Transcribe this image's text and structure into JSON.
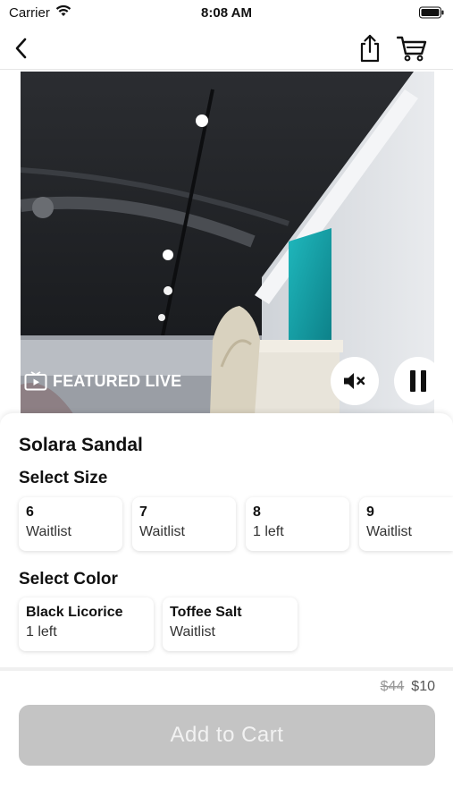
{
  "status_bar": {
    "carrier": "Carrier",
    "time": "8:08 AM"
  },
  "nav": {
    "icons": [
      "back-chevron-icon",
      "share-icon",
      "cart-icon"
    ]
  },
  "video": {
    "badge_label": "FEATURED LIVE",
    "icons": [
      "tv-play-icon",
      "mute-icon",
      "pause-icon"
    ]
  },
  "product": {
    "title": "Solara Sandal",
    "size_label": "Select Size",
    "sizes": [
      {
        "size": "6",
        "status": "Waitlist"
      },
      {
        "size": "7",
        "status": "Waitlist"
      },
      {
        "size": "8",
        "status": "1 left"
      },
      {
        "size": "9",
        "status": "Waitlist"
      }
    ],
    "color_label": "Select Color",
    "colors": [
      {
        "name": "Black Licorice",
        "status": "1 left"
      },
      {
        "name": "Toffee Salt",
        "status": "Waitlist"
      }
    ]
  },
  "pricing": {
    "original_price": "$44",
    "sale_price": "$10"
  },
  "cta": {
    "add_to_cart_label": "Add to Cart"
  }
}
